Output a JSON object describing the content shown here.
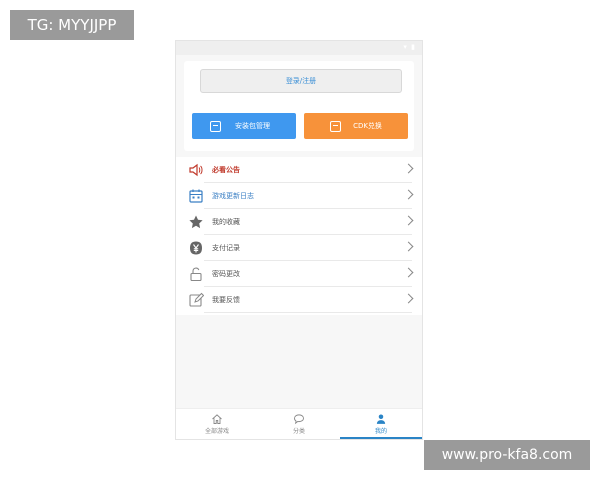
{
  "watermarks": {
    "top": "TG: MYYJJPP",
    "bottom": "www.pro-kfa8.com"
  },
  "header": {
    "login_label": "登录/注册",
    "install_label": "安装包管理",
    "cdk_label": "CDK兑换"
  },
  "menu": {
    "items": [
      {
        "label": "必看公告",
        "icon": "speaker-icon"
      },
      {
        "label": "游戏更新日志",
        "icon": "calendar-icon"
      },
      {
        "label": "我的收藏",
        "icon": "star-icon"
      },
      {
        "label": "支付记录",
        "icon": "yen-icon"
      },
      {
        "label": "密码更改",
        "icon": "lock-icon"
      },
      {
        "label": "我要反馈",
        "icon": "edit-icon"
      }
    ]
  },
  "tabbar": {
    "tabs": [
      {
        "label": "全部游戏",
        "icon": "home-icon"
      },
      {
        "label": "分类",
        "icon": "chat-icon"
      },
      {
        "label": "我的",
        "icon": "user-icon"
      }
    ],
    "active_index": 2
  },
  "colors": {
    "install_button": "#3f98ef",
    "cdk_button": "#f7923a",
    "accent": "#2a84c6",
    "notice": "#c0392b"
  }
}
